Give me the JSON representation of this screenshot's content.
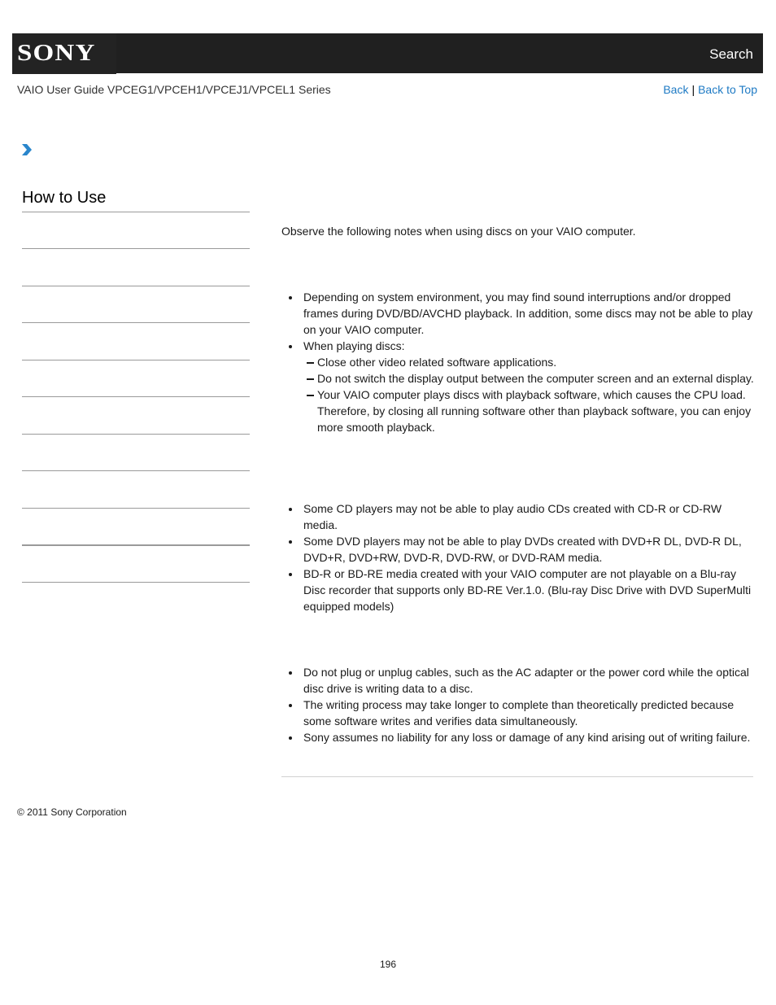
{
  "header": {
    "logo_text": "SONY",
    "search_label": "Search"
  },
  "guide": {
    "title": "VAIO User Guide VPCEG1/VPCEH1/VPCEJ1/VPCEL1 Series",
    "back_label": "Back",
    "separator": "|",
    "back_to_top_label": "Back to Top"
  },
  "colors": {
    "header_bg": "#202020",
    "link": "#1e7ac4",
    "chevron": "#2a86cc",
    "divider": "#9a9a9a"
  },
  "sidebar": {
    "breadcrumb_icon": "chevron-right-icon",
    "title": "How to Use",
    "item_count": 10,
    "active_index": 8
  },
  "content": {
    "intro": "Observe the following notes when using discs on your VAIO computer.",
    "playback": {
      "items": [
        {
          "text": "Depending on system environment, you may find sound interruptions and/or dropped frames during DVD/BD/AVCHD playback. In addition, some discs may not be able to play on your VAIO computer."
        },
        {
          "text": "When playing discs:",
          "subitems": [
            "Close other video related software applications.",
            "Do not switch the display output between the computer screen and an external display.",
            "Your VAIO computer plays discs with playback software, which causes the CPU load. Therefore, by closing all running software other than playback software, you can enjoy more smooth playback."
          ]
        }
      ]
    },
    "compatibility": {
      "items": [
        "Some CD players may not be able to play audio CDs created with CD-R or CD-RW media.",
        "Some DVD players may not be able to play DVDs created with DVD+R DL, DVD-R DL, DVD+R, DVD+RW, DVD-R, DVD-RW, or DVD-RAM media.",
        "BD-R or BD-RE media created with your VAIO computer are not playable on a Blu-ray Disc recorder that supports only BD-RE Ver.1.0. (Blu-ray Disc Drive with DVD SuperMulti equipped models)"
      ]
    },
    "writing": {
      "items": [
        "Do not plug or unplug cables, such as the AC adapter or the power cord while the optical disc drive is writing data to a disc.",
        "The writing process may take longer to complete than theoretically predicted because some software writes and verifies data simultaneously.",
        "Sony assumes no liability for any loss or damage of any kind arising out of writing failure."
      ]
    }
  },
  "footer": {
    "copyright": "© 2011 Sony Corporation",
    "page_number": "196"
  }
}
